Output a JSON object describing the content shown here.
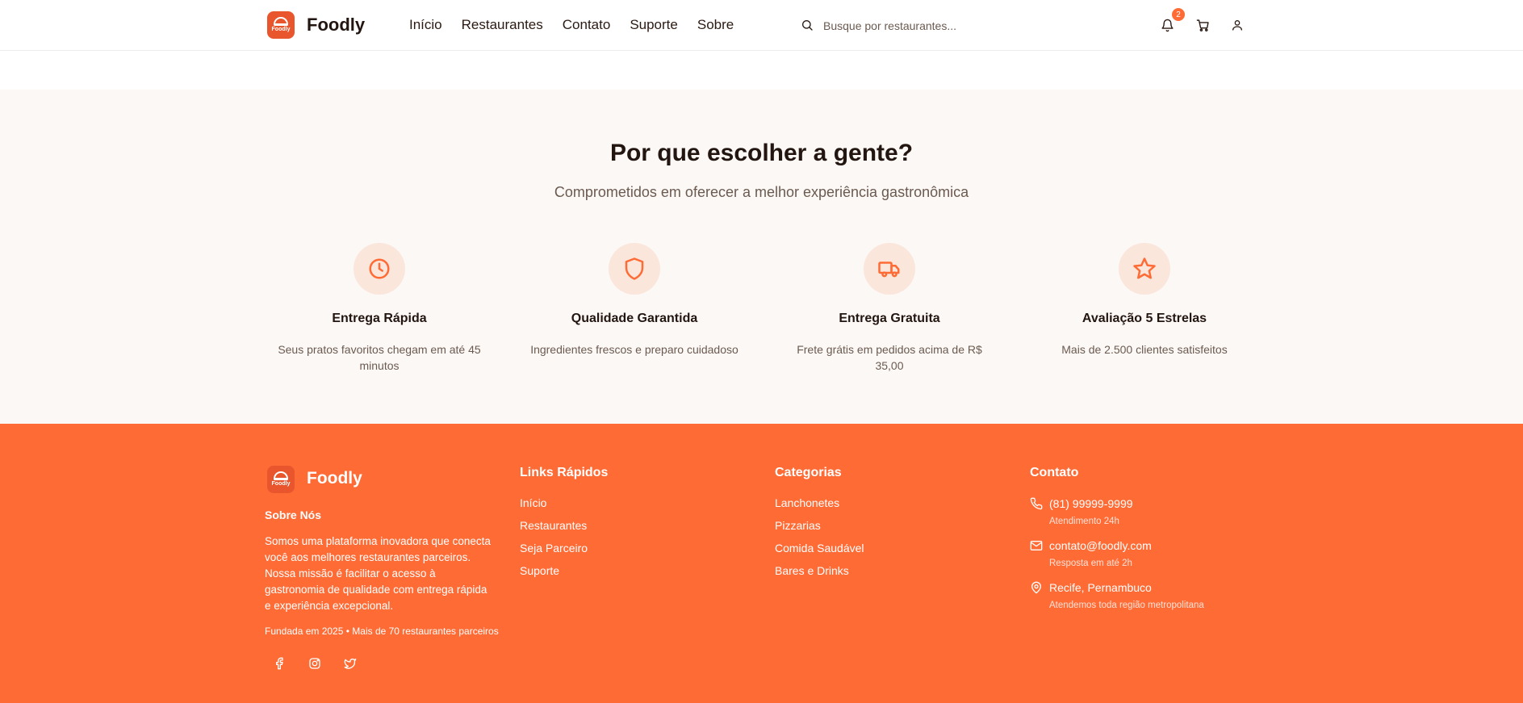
{
  "header": {
    "logo_text": "Foodly",
    "brand": "Foodly",
    "nav": [
      "Início",
      "Restaurantes",
      "Contato",
      "Suporte",
      "Sobre"
    ],
    "search_placeholder": "Busque por restaurantes...",
    "notification_count": "2",
    "icons": [
      "search-icon",
      "bell-icon",
      "cart-icon",
      "user-icon"
    ]
  },
  "why": {
    "title": "Por que escolher a gente?",
    "subtitle": "Comprometidos em oferecer a melhor experiência gastronômica",
    "features": [
      {
        "icon": "clock-icon",
        "title": "Entrega Rápida",
        "desc": "Seus pratos favoritos chegam em até 45 minutos"
      },
      {
        "icon": "shield-icon",
        "title": "Qualidade Garantida",
        "desc": "Ingredientes frescos e preparo cuidadoso"
      },
      {
        "icon": "truck-icon",
        "title": "Entrega Gratuita",
        "desc": "Frete grátis em pedidos acima de R$ 35,00"
      },
      {
        "icon": "star-icon",
        "title": "Avaliação 5 Estrelas",
        "desc": "Mais de 2.500 clientes satisfeitos"
      }
    ]
  },
  "footer": {
    "brand": "Foodly",
    "logo_text": "Foodly",
    "about_title": "Sobre Nós",
    "about_text": "Somos uma plataforma inovadora que conecta você aos melhores restaurantes parceiros. Nossa missão é facilitar o acesso à gastronomia de qualidade com entrega rápida e experiência excepcional.",
    "founded": "Fundada em 2025 • Mais de 70 restaurantes parceiros",
    "social_icons": [
      "facebook-icon",
      "instagram-icon",
      "twitter-icon"
    ],
    "links_title": "Links Rápidos",
    "links": [
      "Início",
      "Restaurantes",
      "Seja Parceiro",
      "Suporte"
    ],
    "categories_title": "Categorias",
    "categories": [
      "Lanchonetes",
      "Pizzarias",
      "Comida Saudável",
      "Bares e Drinks"
    ],
    "contact_title": "Contato",
    "contact": [
      {
        "icon": "phone-icon",
        "main": "(81) 99999-9999",
        "sub": "Atendimento 24h"
      },
      {
        "icon": "mail-icon",
        "main": "contato@foodly.com",
        "sub": "Resposta em até 2h"
      },
      {
        "icon": "map-pin-icon",
        "main": "Recife, Pernambuco",
        "sub": "Atendemos toda região metropolitana"
      }
    ]
  },
  "colors": {
    "accent": "#ff6b35",
    "logo_bg": "#e9552c",
    "section_bg": "#fcf8f5",
    "icon_circle": "#fbe6dc",
    "text_dark": "#231510",
    "text_muted": "#6b5a50"
  }
}
